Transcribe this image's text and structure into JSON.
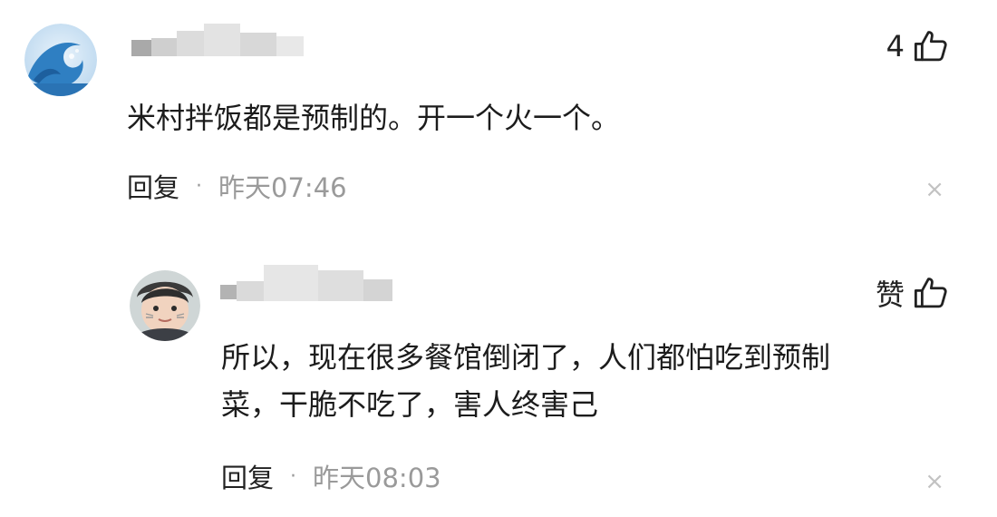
{
  "comments": [
    {
      "likes": "4",
      "content": "米村拌饭都是预制的。开一个火一个。",
      "reply_label": "回复",
      "separator": "·",
      "time": "昨天07:46",
      "close": "×"
    },
    {
      "likes": "赞",
      "content_lines": [
        "所以，现在很多餐馆倒闭了，人们都怕吃到预制",
        "菜，干脆不吃了，害人终害己"
      ],
      "reply_label": "回复",
      "separator": "·",
      "time": "昨天08:03",
      "close": "×"
    }
  ],
  "icons": {
    "like": "thumb-up-icon",
    "close": "close-icon",
    "avatar1": "wave-avatar",
    "avatar2": "child-avatar"
  },
  "colors": {
    "text": "#1c1c1c",
    "meta": "#9a9a9a",
    "close": "#c2c2c2",
    "wave": "#2f7fc2"
  }
}
